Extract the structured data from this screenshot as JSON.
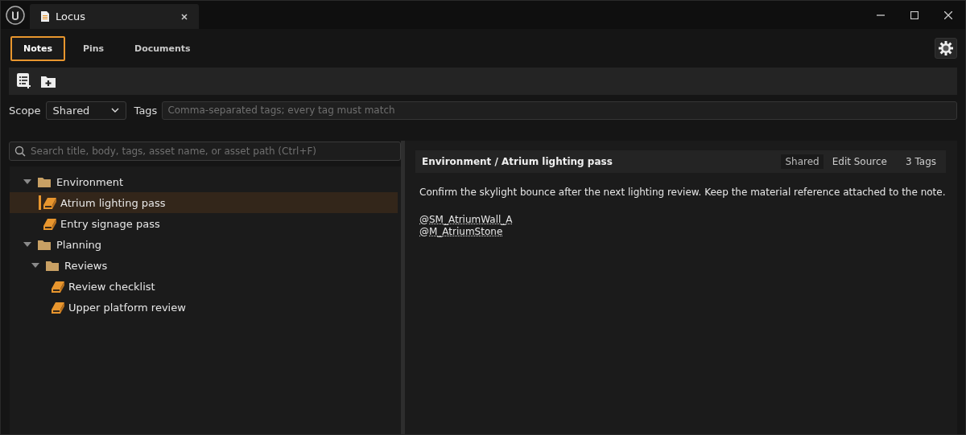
{
  "window": {
    "title": "Locus"
  },
  "mode_tabs": [
    {
      "label": "Notes",
      "selected": true
    },
    {
      "label": "Pins",
      "selected": false
    },
    {
      "label": "Documents",
      "selected": false
    }
  ],
  "filters": {
    "scope_label": "Scope",
    "scope_value": "Shared",
    "tags_label": "Tags",
    "tags_placeholder": "Comma-separated tags; every tag must match"
  },
  "search": {
    "placeholder": "Search title, body, tags, asset name, or asset path (Ctrl+F)"
  },
  "tree": [
    {
      "kind": "folder",
      "label": "Environment",
      "expanded": true,
      "children": [
        {
          "kind": "note",
          "label": "Atrium lighting pass",
          "selected": true
        },
        {
          "kind": "note",
          "label": "Entry signage pass",
          "selected": false
        }
      ]
    },
    {
      "kind": "folder",
      "label": "Planning",
      "expanded": true,
      "children": [
        {
          "kind": "folder",
          "label": "Reviews",
          "expanded": true,
          "children": [
            {
              "kind": "note",
              "label": "Review checklist",
              "selected": false
            },
            {
              "kind": "note",
              "label": "Upper platform review",
              "selected": false
            }
          ]
        }
      ]
    }
  ],
  "note": {
    "path": "Environment / Atrium lighting pass",
    "scope": "Shared",
    "edit_label": "Edit Source",
    "tag_count": "3 Tags",
    "body": "Confirm the skylight bounce after the next lighting review. Keep the material reference attached to the note.",
    "references": [
      "@SM_AtriumWall_A",
      "@M_AtriumStone"
    ]
  }
}
